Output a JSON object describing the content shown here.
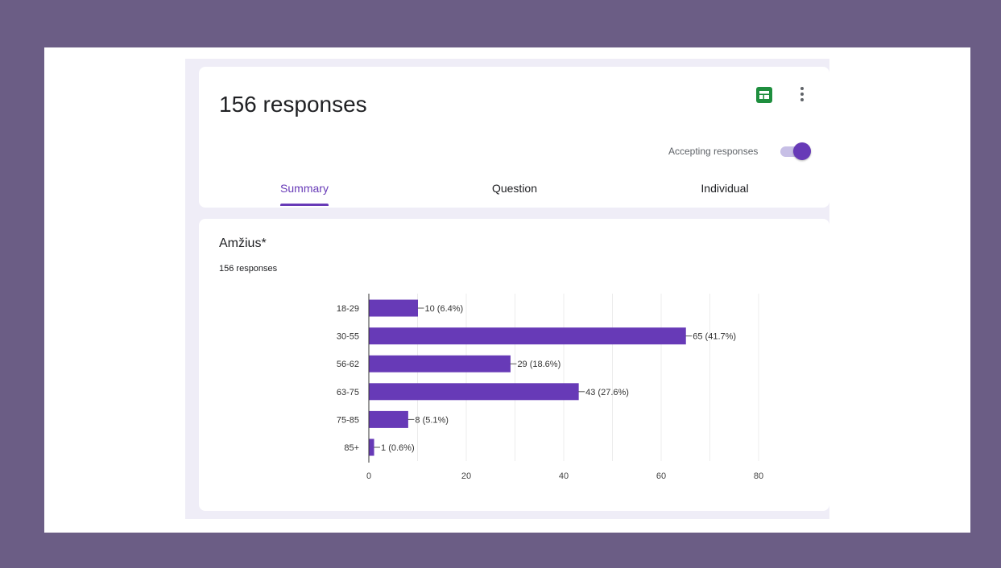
{
  "header": {
    "title": "156 responses",
    "accepting_label": "Accepting responses",
    "accepting": true
  },
  "tabs": [
    {
      "label": "Summary",
      "active": true
    },
    {
      "label": "Question",
      "active": false
    },
    {
      "label": "Individual",
      "active": false
    }
  ],
  "question": {
    "title": "Amžius*",
    "count": "156 responses"
  },
  "colors": {
    "accent": "#673ab7",
    "sheets": "#1e8e3e",
    "frame": "#6b5d85"
  },
  "chart_data": {
    "type": "bar",
    "orientation": "horizontal",
    "categories": [
      "18-29",
      "30-55",
      "56-62",
      "63-75",
      "75-85",
      "85+"
    ],
    "values": [
      10,
      65,
      29,
      43,
      8,
      1
    ],
    "data_labels": [
      "10 (6.4%)",
      "65 (41.7%)",
      "29 (18.6%)",
      "43 (27.6%)",
      "8 (5.1%)",
      "1 (0.6%)"
    ],
    "xlim": [
      0,
      80
    ],
    "xticks": [
      0,
      20,
      40,
      60,
      80
    ],
    "grid": true,
    "color": "#673ab7"
  }
}
